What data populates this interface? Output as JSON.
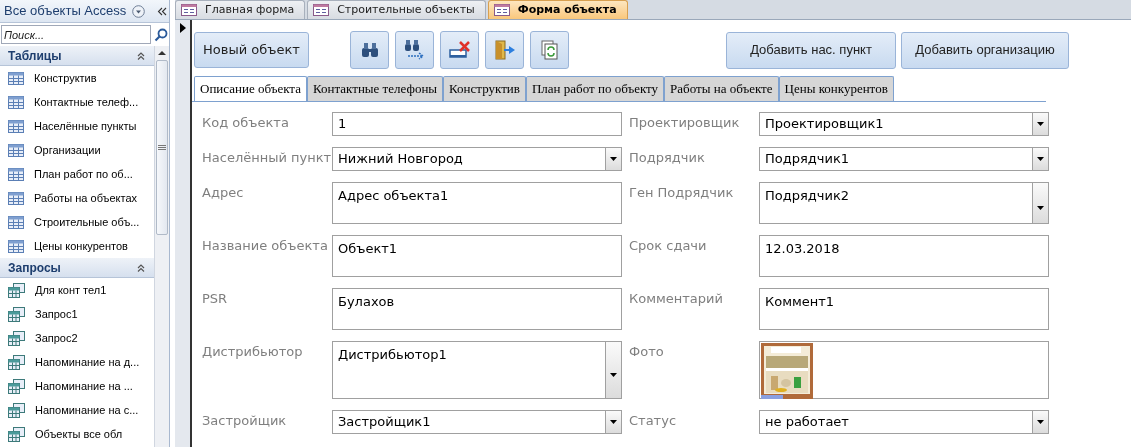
{
  "navigation": {
    "title": "Все объекты Access",
    "search": {
      "placeholder": "Поиск..."
    },
    "groups": [
      {
        "title": "Таблицы",
        "kind": "table",
        "items": [
          "Конструктив",
          "Контактные телеф...",
          "Населённые пункты",
          "Организации",
          "План работ по об...",
          "Работы на объектах",
          "Строительные объ...",
          "Цены конкурентов"
        ]
      },
      {
        "title": "Запросы",
        "kind": "query",
        "items": [
          "Для конт тел1",
          "Запрос1",
          "Запрос2",
          "Напоминание на д...",
          "Напоминание на ...",
          "Напоминание на с...",
          "Объекты все обл"
        ]
      }
    ]
  },
  "document_tabs": [
    {
      "label": "Главная форма",
      "selected": false
    },
    {
      "label": "Строительные объекты",
      "selected": false
    },
    {
      "label": "Форма объекта",
      "selected": true
    }
  ],
  "toolbar": {
    "new_button": "Новый объект",
    "icon_buttons": [
      {
        "kind": "find"
      },
      {
        "kind": "find_next"
      },
      {
        "kind": "delete"
      },
      {
        "kind": "exit"
      },
      {
        "kind": "refresh"
      }
    ],
    "right_buttons": [
      "Добавить нас. пункт",
      "Добавить организацию"
    ]
  },
  "form_tabs": [
    {
      "label": "Описание объекта",
      "selected": true
    },
    {
      "label": "Контактные телефоны",
      "selected": false
    },
    {
      "label": "Конструктив",
      "selected": false
    },
    {
      "label": "План работ по объекту",
      "selected": false
    },
    {
      "label": "Работы на объекте",
      "selected": false
    },
    {
      "label": "Цены конкурентов",
      "selected": false
    }
  ],
  "rows": [
    {
      "left": {
        "label": "Код объекта",
        "kind": "text",
        "value": "1"
      },
      "right": {
        "label": "Проектировщик",
        "kind": "combo",
        "value": "Проектировщик1"
      }
    },
    {
      "left": {
        "label": "Населённый пункт",
        "kind": "combo",
        "value": "Нижний Новгород"
      },
      "right": {
        "label": "Подрядчик",
        "kind": "combo",
        "value": "Подрядчик1"
      }
    },
    {
      "left": {
        "label": "Адрес",
        "kind": "memo",
        "value": "Адрес объекта1"
      },
      "right": {
        "label": "Ген Подрядчик",
        "kind": "memo_combo",
        "value": "Подрядчик2"
      }
    },
    {
      "left": {
        "label": "Название объекта",
        "kind": "memo",
        "value": "Объект1"
      },
      "right": {
        "label": "Срок сдачи",
        "kind": "memo",
        "value": "12.03.2018"
      }
    },
    {
      "left": {
        "label": "PSR",
        "kind": "memo",
        "value": "Булахов"
      },
      "right": {
        "label": "Комментарий",
        "kind": "memo",
        "value": "Коммент1"
      }
    },
    {
      "left": {
        "label": "Дистрибьютор",
        "kind": "memo_combo",
        "value": "Дистрибьютор1"
      },
      "right": {
        "label": "Фото",
        "kind": "picture"
      }
    },
    {
      "left": {
        "label": "Застройщик",
        "kind": "combo",
        "value": "Застройщик1"
      },
      "right": {
        "label": "Статус",
        "kind": "combo",
        "value": "не работает"
      }
    }
  ]
}
